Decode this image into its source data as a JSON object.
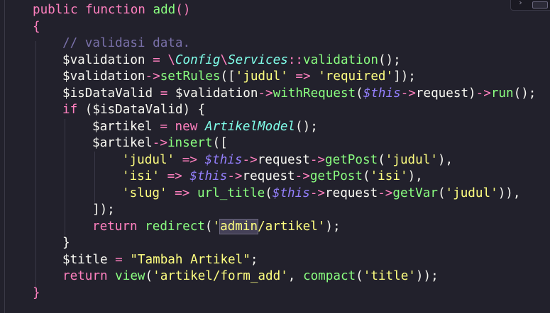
{
  "editor": {
    "lines": [
      {
        "indent": 0,
        "tokens": [
          {
            "t": "public",
            "c": "kw"
          },
          {
            "t": " ",
            "c": "punc"
          },
          {
            "t": "function",
            "c": "kw"
          },
          {
            "t": " ",
            "c": "punc"
          },
          {
            "t": "add",
            "c": "fn"
          },
          {
            "t": "()",
            "c": "brace"
          }
        ]
      },
      {
        "indent": 0,
        "tokens": [
          {
            "t": "{",
            "c": "brace"
          }
        ]
      },
      {
        "indent": 1,
        "tokens": [
          {
            "t": "// validasi data.",
            "c": "cmt"
          }
        ]
      },
      {
        "indent": 1,
        "tokens": [
          {
            "t": "$validation",
            "c": "var"
          },
          {
            "t": " ",
            "c": "punc"
          },
          {
            "t": "=",
            "c": "op"
          },
          {
            "t": " ",
            "c": "punc"
          },
          {
            "t": "\\",
            "c": "op"
          },
          {
            "t": "Config",
            "c": "cls"
          },
          {
            "t": "\\",
            "c": "op"
          },
          {
            "t": "Services",
            "c": "cls"
          },
          {
            "t": "::",
            "c": "op"
          },
          {
            "t": "validation",
            "c": "fn"
          },
          {
            "t": "();",
            "c": "punc"
          }
        ]
      },
      {
        "indent": 1,
        "tokens": [
          {
            "t": "$validation",
            "c": "var"
          },
          {
            "t": "->",
            "c": "op"
          },
          {
            "t": "setRules",
            "c": "fn"
          },
          {
            "t": "([",
            "c": "punc"
          },
          {
            "t": "'judul'",
            "c": "str"
          },
          {
            "t": " ",
            "c": "punc"
          },
          {
            "t": "=>",
            "c": "op"
          },
          {
            "t": " ",
            "c": "punc"
          },
          {
            "t": "'required'",
            "c": "str"
          },
          {
            "t": "]);",
            "c": "punc"
          }
        ]
      },
      {
        "indent": 1,
        "tokens": [
          {
            "t": "$isDataValid",
            "c": "var"
          },
          {
            "t": " ",
            "c": "punc"
          },
          {
            "t": "=",
            "c": "op"
          },
          {
            "t": " ",
            "c": "punc"
          },
          {
            "t": "$validation",
            "c": "var"
          },
          {
            "t": "->",
            "c": "op"
          },
          {
            "t": "withRequest",
            "c": "fn"
          },
          {
            "t": "(",
            "c": "punc"
          },
          {
            "t": "$this",
            "c": "this"
          },
          {
            "t": "->",
            "c": "op"
          },
          {
            "t": "request",
            "c": "var"
          },
          {
            "t": ")",
            "c": "punc"
          },
          {
            "t": "->",
            "c": "op"
          },
          {
            "t": "run",
            "c": "fn"
          },
          {
            "t": "();",
            "c": "punc"
          }
        ]
      },
      {
        "indent": 1,
        "tokens": [
          {
            "t": "if",
            "c": "kw"
          },
          {
            "t": " (",
            "c": "punc"
          },
          {
            "t": "$isDataValid",
            "c": "var"
          },
          {
            "t": ") {",
            "c": "punc"
          }
        ]
      },
      {
        "indent": 2,
        "tokens": [
          {
            "t": "$artikel",
            "c": "var"
          },
          {
            "t": " ",
            "c": "punc"
          },
          {
            "t": "=",
            "c": "op"
          },
          {
            "t": " ",
            "c": "punc"
          },
          {
            "t": "new",
            "c": "kw"
          },
          {
            "t": " ",
            "c": "punc"
          },
          {
            "t": "ArtikelModel",
            "c": "cls"
          },
          {
            "t": "();",
            "c": "punc"
          }
        ]
      },
      {
        "indent": 2,
        "tokens": [
          {
            "t": "$artikel",
            "c": "var"
          },
          {
            "t": "->",
            "c": "op"
          },
          {
            "t": "insert",
            "c": "fn"
          },
          {
            "t": "([",
            "c": "punc"
          }
        ]
      },
      {
        "indent": 3,
        "tokens": [
          {
            "t": "'judul'",
            "c": "str"
          },
          {
            "t": " ",
            "c": "punc"
          },
          {
            "t": "=>",
            "c": "op"
          },
          {
            "t": " ",
            "c": "punc"
          },
          {
            "t": "$this",
            "c": "this"
          },
          {
            "t": "->",
            "c": "op"
          },
          {
            "t": "request",
            "c": "var"
          },
          {
            "t": "->",
            "c": "op"
          },
          {
            "t": "getPost",
            "c": "fn"
          },
          {
            "t": "(",
            "c": "punc"
          },
          {
            "t": "'judul'",
            "c": "str"
          },
          {
            "t": "),",
            "c": "punc"
          }
        ]
      },
      {
        "indent": 3,
        "tokens": [
          {
            "t": "'isi'",
            "c": "str"
          },
          {
            "t": " ",
            "c": "punc"
          },
          {
            "t": "=>",
            "c": "op"
          },
          {
            "t": " ",
            "c": "punc"
          },
          {
            "t": "$this",
            "c": "this"
          },
          {
            "t": "->",
            "c": "op"
          },
          {
            "t": "request",
            "c": "var"
          },
          {
            "t": "->",
            "c": "op"
          },
          {
            "t": "getPost",
            "c": "fn"
          },
          {
            "t": "(",
            "c": "punc"
          },
          {
            "t": "'isi'",
            "c": "str"
          },
          {
            "t": "),",
            "c": "punc"
          }
        ]
      },
      {
        "indent": 3,
        "tokens": [
          {
            "t": "'slug'",
            "c": "str"
          },
          {
            "t": " ",
            "c": "punc"
          },
          {
            "t": "=>",
            "c": "op"
          },
          {
            "t": " ",
            "c": "punc"
          },
          {
            "t": "url_title",
            "c": "fn"
          },
          {
            "t": "(",
            "c": "punc"
          },
          {
            "t": "$this",
            "c": "this"
          },
          {
            "t": "->",
            "c": "op"
          },
          {
            "t": "request",
            "c": "var"
          },
          {
            "t": "->",
            "c": "op"
          },
          {
            "t": "getVar",
            "c": "fn"
          },
          {
            "t": "(",
            "c": "punc"
          },
          {
            "t": "'judul'",
            "c": "str"
          },
          {
            "t": ")),",
            "c": "punc"
          }
        ]
      },
      {
        "indent": 2,
        "tokens": [
          {
            "t": "]);",
            "c": "punc"
          }
        ]
      },
      {
        "indent": 2,
        "tokens": [
          {
            "t": "return",
            "c": "kw"
          },
          {
            "t": " ",
            "c": "punc"
          },
          {
            "t": "redirect",
            "c": "fn"
          },
          {
            "t": "(",
            "c": "punc"
          },
          {
            "t": "'",
            "c": "str"
          },
          {
            "t": "admin",
            "c": "hl"
          },
          {
            "t": "/artikel'",
            "c": "str"
          },
          {
            "t": ");",
            "c": "punc"
          }
        ]
      },
      {
        "indent": 1,
        "tokens": [
          {
            "t": "}",
            "c": "punc"
          }
        ]
      },
      {
        "indent": 1,
        "tokens": [
          {
            "t": "$title",
            "c": "var"
          },
          {
            "t": " ",
            "c": "punc"
          },
          {
            "t": "=",
            "c": "op"
          },
          {
            "t": " ",
            "c": "punc"
          },
          {
            "t": "\"Tambah Artikel\"",
            "c": "str"
          },
          {
            "t": ";",
            "c": "punc"
          }
        ]
      },
      {
        "indent": 1,
        "tokens": [
          {
            "t": "return",
            "c": "kw"
          },
          {
            "t": " ",
            "c": "punc"
          },
          {
            "t": "view",
            "c": "fn"
          },
          {
            "t": "(",
            "c": "punc"
          },
          {
            "t": "'artikel/form_add'",
            "c": "str"
          },
          {
            "t": ", ",
            "c": "punc"
          },
          {
            "t": "compact",
            "c": "fn"
          },
          {
            "t": "(",
            "c": "punc"
          },
          {
            "t": "'title'",
            "c": "str"
          },
          {
            "t": "));",
            "c": "punc"
          }
        ]
      },
      {
        "indent": 0,
        "tokens": [
          {
            "t": "}",
            "c": "brace"
          }
        ]
      }
    ]
  },
  "corner_tab": {
    "glyph": "›"
  },
  "colors": {
    "background": "#22212c",
    "keyword": "#ff80bf",
    "function": "#8aff80",
    "string": "#ffff80",
    "class": "#80ffea",
    "this": "#9580ff",
    "comment": "#7970a9",
    "text": "#f8f8f2"
  }
}
